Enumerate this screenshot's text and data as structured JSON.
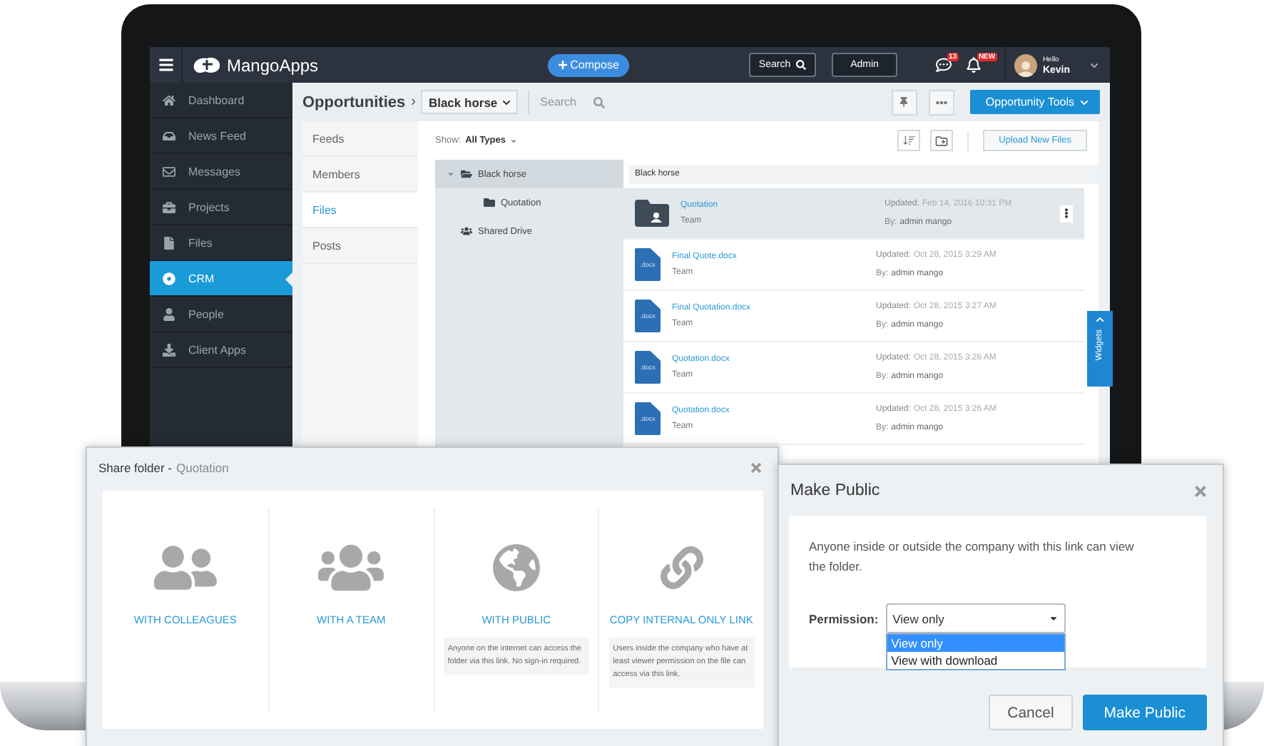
{
  "topbar": {
    "brand": "MangoApps",
    "compose": "Compose",
    "search": "Search",
    "admin": "Admin",
    "message_badge": "13",
    "alert_badge": "NEW",
    "greeting": "Hello",
    "user": "Kevin"
  },
  "sidebar": {
    "items": [
      {
        "label": "Dashboard",
        "selected": false
      },
      {
        "label": "News Feed",
        "selected": false
      },
      {
        "label": "Messages",
        "selected": false
      },
      {
        "label": "Projects",
        "selected": false
      },
      {
        "label": "Files",
        "selected": false
      },
      {
        "label": "CRM",
        "selected": true
      },
      {
        "label": "People",
        "selected": false
      },
      {
        "label": "Client Apps",
        "selected": false
      }
    ]
  },
  "header": {
    "section": "Opportunities",
    "separator": "›",
    "current": "Black horse",
    "search_placeholder": "Search",
    "tools_button": "Opportunity Tools"
  },
  "subnav": [
    {
      "label": "Feeds",
      "selected": false
    },
    {
      "label": "Members",
      "selected": false
    },
    {
      "label": "Files",
      "selected": true
    },
    {
      "label": "Posts",
      "selected": false
    }
  ],
  "filter": {
    "label": "Show:",
    "value": "All Types"
  },
  "upload_button": "Upload New Files",
  "tree": [
    {
      "label": "Black horse",
      "kind": "folder",
      "selected": true,
      "expanded": true,
      "children": [
        {
          "label": "Quotation",
          "kind": "folder",
          "selected": false
        }
      ]
    },
    {
      "label": "Shared Drive",
      "kind": "shared",
      "selected": false
    }
  ],
  "files": {
    "folder": "Black horse",
    "rows": [
      {
        "kind": "folder",
        "name": "Quotation",
        "owner": "Team",
        "updated_label": "Updated:",
        "updated": "Feb 14, 2016 10:31 PM",
        "by_label": "By:",
        "by": "admin mango",
        "selected": true
      },
      {
        "kind": "docx",
        "icon_text": ".docx",
        "name": "Final Quote.docx",
        "owner": "Team",
        "updated_label": "Updated:",
        "updated": "Oct 28, 2015 3:29 AM",
        "by_label": "By:",
        "by": "admin mango",
        "selected": false
      },
      {
        "kind": "docx",
        "icon_text": ".docx",
        "name": "Final Quotation.docx",
        "owner": "Team",
        "updated_label": "Updated:",
        "updated": "Oct 28, 2015 3:27 AM",
        "by_label": "By:",
        "by": "admin mango",
        "selected": false
      },
      {
        "kind": "docx",
        "icon_text": ".docx",
        "name": "Quotation.docx",
        "owner": "Team",
        "updated_label": "Updated:",
        "updated": "Oct 28, 2015 3:26 AM",
        "by_label": "By:",
        "by": "admin mango",
        "selected": false
      },
      {
        "kind": "docx",
        "icon_text": ".docx",
        "name": "Quotation.docx",
        "owner": "Team",
        "updated_label": "Updated:",
        "updated": "Oct 28, 2015 3:26 AM",
        "by_label": "By:",
        "by": "admin mango",
        "selected": false
      }
    ]
  },
  "widgets_tab": "Widgets",
  "share_dialog": {
    "title": "Share folder -",
    "folder": "Quotation",
    "options": [
      {
        "kind": "colleagues",
        "label": "WITH COLLEAGUES"
      },
      {
        "kind": "team",
        "label": "WITH A TEAM"
      },
      {
        "kind": "public",
        "label": "WITH PUBLIC",
        "note": "Anyone on the internet can access the folder via this link. No sign-in required."
      },
      {
        "kind": "link",
        "label": "COPY INTERNAL ONLY LINK",
        "note": "Users inside the company who have at least viewer permission on the file can access via this link."
      }
    ]
  },
  "public_dialog": {
    "title": "Make Public",
    "message": "Anyone inside or outside the company with this link can view the folder.",
    "permission_label": "Permission:",
    "permission_value": "View only",
    "options": [
      {
        "label": "View only",
        "selected": true
      },
      {
        "label": "View with download",
        "selected": false
      }
    ],
    "buttons": [
      {
        "kind": "secondary",
        "label": "Cancel"
      },
      {
        "kind": "primary",
        "label": "Make Public"
      }
    ]
  }
}
